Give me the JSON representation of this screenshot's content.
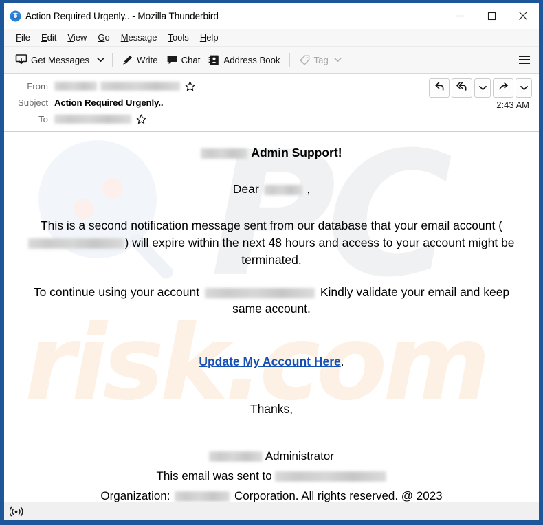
{
  "window": {
    "title": "Action Required Urgenly.. - Mozilla Thunderbird",
    "app_icon": "thunderbird-icon",
    "controls": {
      "minimize": "minimize-icon",
      "maximize": "maximize-icon",
      "close": "close-icon"
    },
    "border_color": "#1e5799"
  },
  "menubar": {
    "items": [
      {
        "label": "File",
        "accel": "F"
      },
      {
        "label": "Edit",
        "accel": "E"
      },
      {
        "label": "View",
        "accel": "V"
      },
      {
        "label": "Go",
        "accel": "G"
      },
      {
        "label": "Message",
        "accel": "M"
      },
      {
        "label": "Tools",
        "accel": "T"
      },
      {
        "label": "Help",
        "accel": "H"
      }
    ]
  },
  "toolbar": {
    "get_messages": "Get Messages",
    "write": "Write",
    "chat": "Chat",
    "address_book": "Address Book",
    "tag": "Tag",
    "app_menu": "app-menu-icon"
  },
  "message_header": {
    "from_label": "From",
    "from_value_redacted": true,
    "subject_label": "Subject",
    "subject_value": "Action Required Urgenly..",
    "to_label": "To",
    "to_value_redacted": true,
    "time": "2:43 AM",
    "actions": [
      {
        "name": "reply-button",
        "icon": "reply-icon"
      },
      {
        "name": "reply-all-button",
        "icon": "reply-all-icon"
      },
      {
        "name": "reply-all-dropdown",
        "icon": "chevron-down-icon"
      },
      {
        "name": "forward-button",
        "icon": "forward-icon"
      },
      {
        "name": "forward-dropdown",
        "icon": "chevron-down-icon"
      }
    ]
  },
  "body": {
    "heading_suffix": "Admin Support!",
    "greeting": "Dear",
    "greeting_comma": ",",
    "paragraph1_part1": "This is a second notification message sent from our database that your email account",
    "paragraph1_open_paren": "(",
    "paragraph1_part2": ") will expire within the next 48 hours and access to your account might be terminated.",
    "paragraph2_part1": "To  continue using your account",
    "paragraph2_part2": "Kindly validate your email and keep same account.",
    "link_text": "Update My Account Here",
    "link_period": ".",
    "thanks": "Thanks,",
    "administrator": "Administrator",
    "sent_to": "This email was sent to",
    "organization_label": "Organization:",
    "organization_suffix": "Corporation. All rights reserved. @ 2023",
    "link_color": "#1450b4"
  },
  "watermark": {
    "top_text": "PC",
    "bottom_text": "risk.com",
    "top_color": "#f0f1f3",
    "bottom_color": "#fdf0e4"
  },
  "statusbar": {
    "icon": "broadcast-icon"
  }
}
